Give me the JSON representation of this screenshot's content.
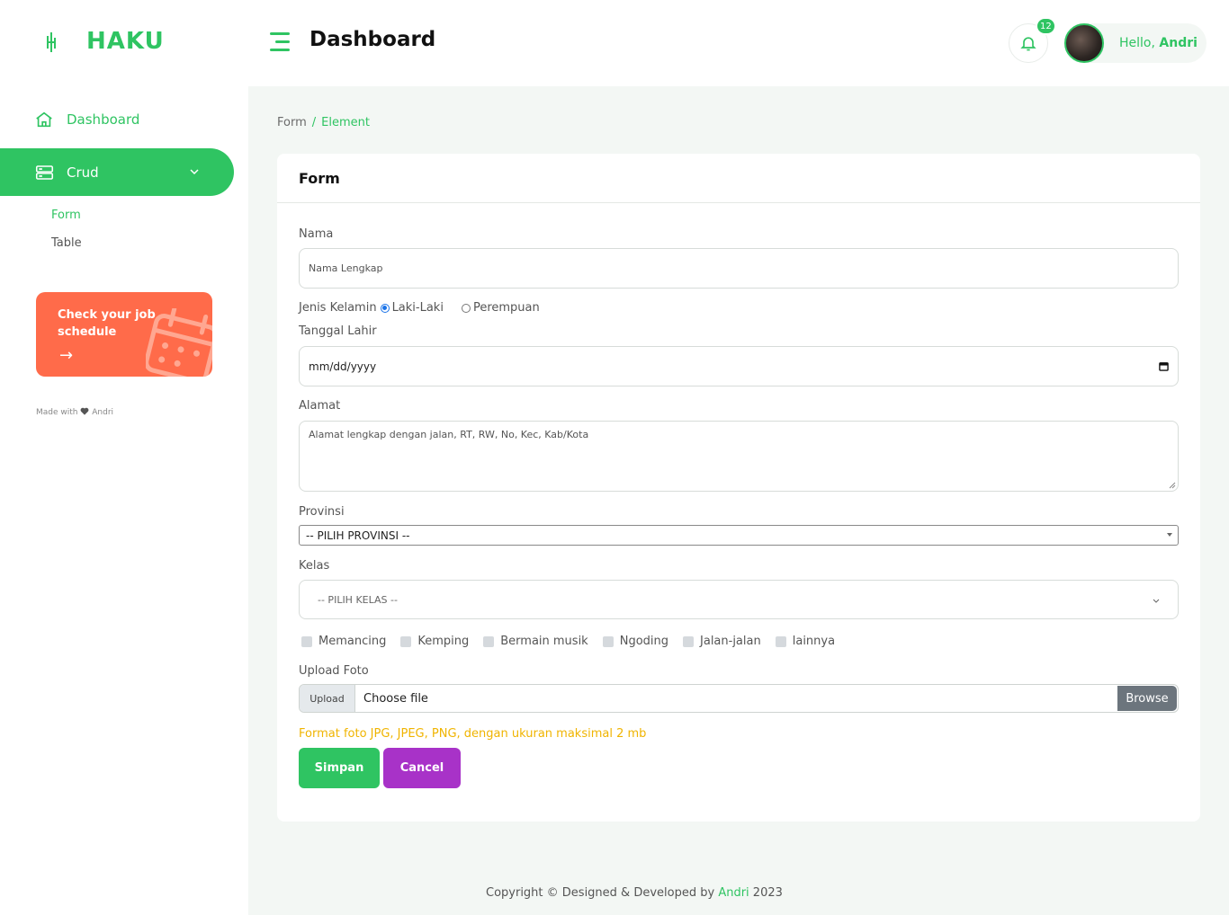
{
  "header": {
    "brand": "HAKU",
    "title": "Dashboard",
    "notification_count": "12",
    "greeting_prefix": "Hello,",
    "user_name": "Andri"
  },
  "sidebar": {
    "dashboard_label": "Dashboard",
    "crud_label": "Crud",
    "sub_items": [
      "Form",
      "Table"
    ],
    "promo_text": "Check your job schedule",
    "promo_arrow": "→",
    "made_with": "Made with",
    "made_by": "Andri"
  },
  "breadcrumb": {
    "parent": "Form",
    "separator": "/",
    "current": "Element"
  },
  "form": {
    "card_title": "Form",
    "nama_label": "Nama",
    "nama_placeholder": "Nama Lengkap",
    "gender_label": "Jenis Kelamin",
    "gender_options": [
      "Laki-Laki",
      "Perempuan"
    ],
    "gender_selected": "Laki-Laki",
    "tanggal_label": "Tanggal Lahir",
    "tanggal_value": "mm/dd/yyyy",
    "alamat_label": "Alamat",
    "alamat_placeholder": "Alamat lengkap dengan jalan, RT, RW, No, Kec, Kab/Kota",
    "provinsi_label": "Provinsi",
    "provinsi_selected": "-- PILIH PROVINSI --",
    "kelas_label": "Kelas",
    "kelas_selected": "-- PILIH KELAS --",
    "hobbies": [
      "Memancing",
      "Kemping",
      "Bermain musik",
      "Ngoding",
      "Jalan-jalan",
      "lainnya"
    ],
    "upload_label": "Upload Foto",
    "upload_prefix": "Upload",
    "upload_placeholder": "Choose file",
    "upload_browse": "Browse",
    "upload_hint": "Format foto JPG, JPEG, PNG, dengan ukuran maksimal 2 mb",
    "save_label": "Simpan",
    "cancel_label": "Cancel"
  },
  "footer": {
    "text": "Copyright © Designed & Developed by",
    "author": "Andri",
    "year": "2023"
  },
  "colors": {
    "accent": "#2fc462",
    "promo": "#ff6b4a",
    "cancel": "#a832c8",
    "hint": "#f0b400",
    "background": "#f3f7f4"
  }
}
